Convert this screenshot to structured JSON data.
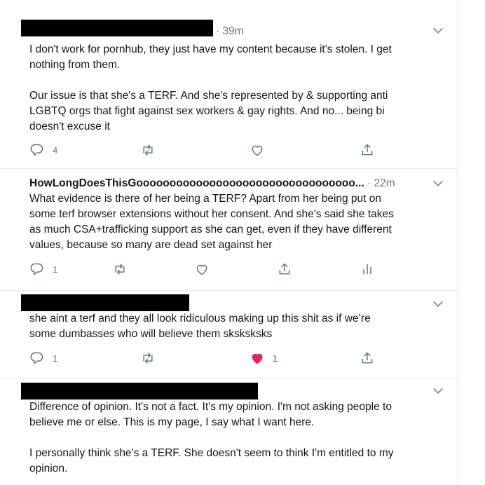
{
  "tweets": [
    {
      "time": "· 39m",
      "text": "I don't work for pornhub, they just have my content because it's stolen. I get\nnothing from them.\n\nOur issue is that she's a TERF. And she's represented by & supporting anti\nLGBTQ orgs that fight against sex workers & gay rights. And no... being bi\ndoesn't excuse it",
      "reply_count": "4"
    },
    {
      "author": "HowLongDoesThisGooooooooooooooooooooooooooooooooo...",
      "time": "· 22m",
      "text": "What evidence is there of her being a TERF? Apart from her being put on\nsome terf browser extensions without her consent. And she's said she takes\nas much CSA+trafficking support as she can get, even if they have different\nvalues, because so many are dead set against her",
      "reply_count": "1"
    },
    {
      "text": "she aint a terf and they all look ridiculous making up this shit as if we’re\nsome dumbasses who will believe them sksksksks",
      "reply_count": "1",
      "like_count": "1",
      "liked": true
    },
    {
      "text": "Difference of opinion. It's not a fact. It's my opinion. I'm not asking people to\nbelieve me or else. This is my page, I say what I want here.\n\nI personally think she's a TERF. She doesn't seem to think I'm entitled to my\nopinion."
    }
  ],
  "colors": {
    "text": "#14171a",
    "secondary": "#657786",
    "icon": "#657786",
    "like_active": "#e0245e",
    "divider": "#e6ecf0"
  },
  "icons": [
    "reply-icon",
    "retweet-icon",
    "like-icon",
    "share-icon",
    "analytics-icon",
    "chevron-down-icon"
  ]
}
